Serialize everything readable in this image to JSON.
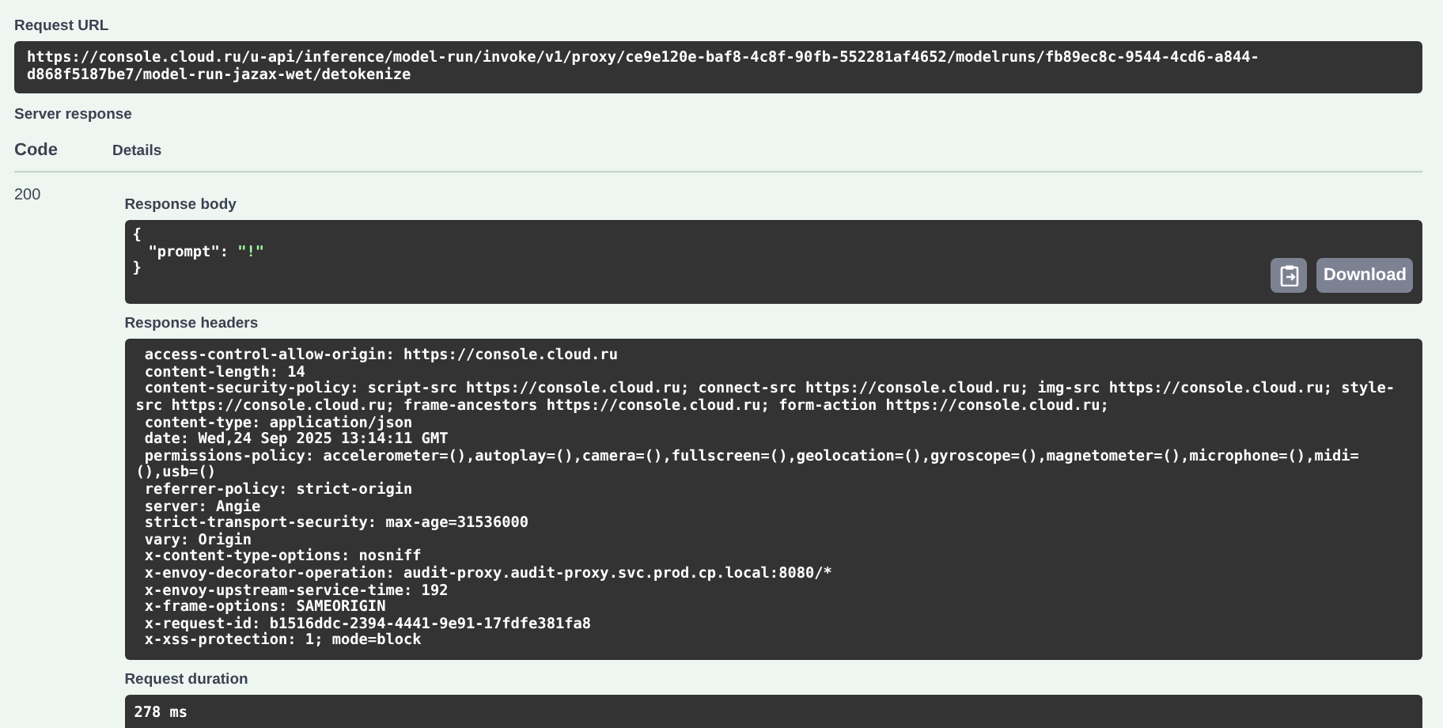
{
  "request_url": {
    "label": "Request URL",
    "value": "https://console.cloud.ru/u-api/inference/model-run/invoke/v1/proxy/ce9e120e-baf8-4c8f-90fb-552281af4652/modelruns/fb89ec8c-9544-4cd6-a844-d868f5187be7/model-run-jazax-wet/detokenize"
  },
  "server_response": {
    "label": "Server response",
    "columns": [
      "Code",
      "Details"
    ],
    "code": "200",
    "body": {
      "label": "Response body",
      "open": "{",
      "lines": [
        {
          "key": "\"prompt\":",
          "value": "\"!\""
        }
      ],
      "close": "}",
      "download": "Download"
    },
    "headers": {
      "label": "Response headers",
      "lines": [
        "access-control-allow-origin: https://console.cloud.ru",
        "content-length: 14",
        "content-security-policy: script-src https://console.cloud.ru; connect-src https://console.cloud.ru; img-src https://console.cloud.ru; style-src https://console.cloud.ru; frame-ancestors https://console.cloud.ru; form-action https://console.cloud.ru;",
        "content-type: application/json",
        "date: Wed,24 Sep 2025 13:14:11 GMT",
        "permissions-policy: accelerometer=(),autoplay=(),camera=(),fullscreen=(),geolocation=(),gyroscope=(),magnetometer=(),microphone=(),midi=(),usb=()",
        "referrer-policy: strict-origin",
        "server: Angie",
        "strict-transport-security: max-age=31536000",
        "vary: Origin",
        "x-content-type-options: nosniff",
        "x-envoy-decorator-operation: audit-proxy.audit-proxy.svc.prod.cp.local:8080/*",
        "x-envoy-upstream-service-time: 192",
        "x-frame-options: SAMEORIGIN",
        "x-request-id: b1516ddc-2394-4441-9e91-17fdfe381fa8",
        "x-xss-protection: 1; mode=block"
      ]
    },
    "duration": {
      "label": "Request duration",
      "value": "278 ms"
    }
  }
}
